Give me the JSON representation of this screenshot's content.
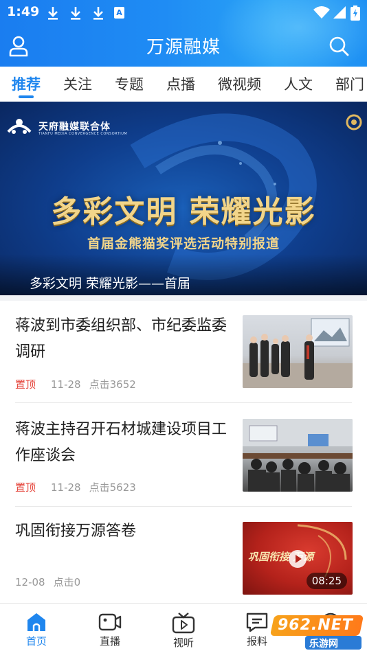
{
  "status_bar": {
    "time": "1:49",
    "notification_icons": [
      "download-icon",
      "download-icon",
      "download-icon",
      "a-app-icon"
    ],
    "system_icons": [
      "wifi-icon",
      "signal-icon",
      "battery-charging-icon"
    ]
  },
  "header": {
    "title": "万源融媒",
    "left_icon": "user-icon",
    "right_icon": "search-icon",
    "accent_color": "#1f86ee"
  },
  "tabs": [
    {
      "label": "推荐",
      "active": true
    },
    {
      "label": "关注",
      "active": false
    },
    {
      "label": "专题",
      "active": false
    },
    {
      "label": "点播",
      "active": false
    },
    {
      "label": "微视频",
      "active": false
    },
    {
      "label": "人文",
      "active": false
    },
    {
      "label": "部门",
      "active": false
    }
  ],
  "banner": {
    "org_name": "天府融媒联合体",
    "org_subtitle": "TIANFU MEDIA CONVERGENCE CONSORTIUM",
    "headline": "多彩文明 荣耀光影",
    "subline": "首届金熊猫奖评选活动特别报道",
    "caption": "多彩文明 荣耀光影——首届"
  },
  "news": [
    {
      "title": "蒋波到市委组织部、市纪委监委调研",
      "pin": "置顶",
      "date": "11-28",
      "clicks": "点击3652"
    },
    {
      "title": "蒋波主持召开石材城建设项目工作座谈会",
      "pin": "置顶",
      "date": "11-28",
      "clicks": "点击5623"
    },
    {
      "title": "巩固衔接万源答卷",
      "date": "12-08",
      "clicks": "点击0",
      "duration": "08:25",
      "thumb_text": "巩固衔接 万源"
    }
  ],
  "bottom_nav": [
    {
      "label": "首页",
      "icon": "home-icon",
      "active": true
    },
    {
      "label": "直播",
      "icon": "video-camera-icon",
      "active": false
    },
    {
      "label": "视听",
      "icon": "tv-play-icon",
      "active": false
    },
    {
      "label": "报料",
      "icon": "message-icon",
      "active": false
    },
    {
      "label": "",
      "icon": "profile-circle-icon",
      "active": false
    }
  ],
  "watermark": {
    "text": "962.NET",
    "subtext": "乐游网"
  }
}
